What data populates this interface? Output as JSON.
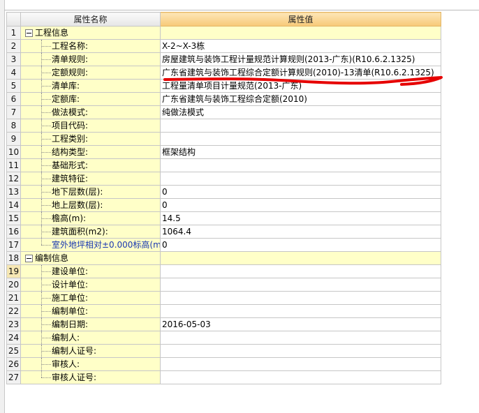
{
  "header": {
    "col_name": "属性名称",
    "col_value": "属性值"
  },
  "rows": [
    {
      "num": "1",
      "name": "工程信息",
      "value": "",
      "type": "group"
    },
    {
      "num": "2",
      "name": "工程名称:",
      "value": "X-2~X-3栋"
    },
    {
      "num": "3",
      "name": "清单规则:",
      "value": "房屋建筑与装饰工程计量规范计算规则(2013-广东)(R10.6.2.1325)"
    },
    {
      "num": "4",
      "name": "定额规则:",
      "value": "广东省建筑与装饰工程综合定额计算规则(2010)-13清单(R10.6.2.1325)"
    },
    {
      "num": "5",
      "name": "清单库:",
      "value": "工程量清单项目计量规范(2013-广东)"
    },
    {
      "num": "6",
      "name": "定额库:",
      "value": "广东省建筑与装饰工程综合定额(2010)"
    },
    {
      "num": "7",
      "name": "做法模式:",
      "value": "纯做法模式"
    },
    {
      "num": "8",
      "name": "项目代码:",
      "value": ""
    },
    {
      "num": "9",
      "name": "工程类别:",
      "value": ""
    },
    {
      "num": "10",
      "name": "结构类型:",
      "value": "框架结构"
    },
    {
      "num": "11",
      "name": "基础形式:",
      "value": ""
    },
    {
      "num": "12",
      "name": "建筑特征:",
      "value": ""
    },
    {
      "num": "13",
      "name": "地下层数(层):",
      "value": "0"
    },
    {
      "num": "14",
      "name": "地上层数(层):",
      "value": "0"
    },
    {
      "num": "15",
      "name": "檐高(m):",
      "value": "14.5"
    },
    {
      "num": "16",
      "name": "建筑面积(m2):",
      "value": "1064.4"
    },
    {
      "num": "17",
      "name": "室外地坪相对±0.000标高(m):",
      "value": "0",
      "blue": true
    },
    {
      "num": "18",
      "name": "编制信息",
      "value": "",
      "type": "group"
    },
    {
      "num": "19",
      "name": "建设单位:",
      "value": "",
      "selected": true
    },
    {
      "num": "20",
      "name": "设计单位:",
      "value": ""
    },
    {
      "num": "21",
      "name": "施工单位:",
      "value": ""
    },
    {
      "num": "22",
      "name": "编制单位:",
      "value": ""
    },
    {
      "num": "23",
      "name": "编制日期:",
      "value": "2016-05-03"
    },
    {
      "num": "24",
      "name": "编制人:",
      "value": ""
    },
    {
      "num": "25",
      "name": "编制人证号:",
      "value": ""
    },
    {
      "num": "26",
      "name": "审核人:",
      "value": ""
    },
    {
      "num": "27",
      "name": "审核人证号:",
      "value": ""
    }
  ],
  "colors": {
    "name_cell_bg": "#ffffc8",
    "header_value_bg": "#f7c978",
    "annotation_stroke": "#e60000",
    "blue_label": "#1a38b0"
  }
}
